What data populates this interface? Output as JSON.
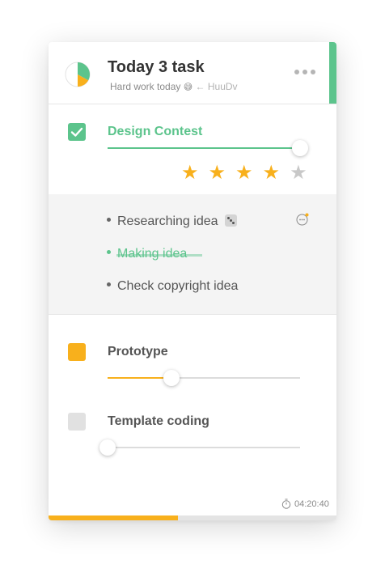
{
  "header": {
    "title": "Today 3 task",
    "subtitle": "Hard work today",
    "subtitle_emoji": "😅",
    "author": "← HuuDv",
    "progress_fractions": {
      "done": 0.33,
      "partial": 0.17
    },
    "menu_icon": "more-dots-icon"
  },
  "tasks": [
    {
      "title": "Design Contest",
      "status": "done",
      "progress": 1.0,
      "rating": 4,
      "rating_max": 5
    },
    {
      "title": "Prototype",
      "status": "in-progress",
      "progress": 0.33
    },
    {
      "title": "Template coding",
      "status": "todo",
      "progress": 0.0
    }
  ],
  "subtasks": [
    {
      "label": "Researching idea",
      "done": false,
      "icon": "dice-icon"
    },
    {
      "label": "Making idea",
      "done": true
    },
    {
      "label": "Check copyright idea",
      "done": false
    }
  ],
  "footer": {
    "timer": "04:20:40",
    "timer_icon": "stopwatch-icon",
    "overall_progress": 0.45
  },
  "colors": {
    "green": "#5cc48c",
    "orange": "#f8b01c",
    "gray": "#e1e1e1",
    "star_off": "#c8c8c8"
  }
}
